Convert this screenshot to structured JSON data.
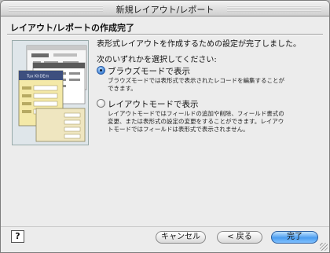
{
  "window": {
    "title": "新規レイアウト/レポート"
  },
  "heading": "レイアウト/レポートの作成完了",
  "lead": "表形式レイアウトを作成するための設定が完了しました。",
  "prompt": "次のいずれかを選択してください:",
  "options": [
    {
      "label": "ブラウズモードで表示",
      "selected": true,
      "description_lines": [
        "ブラウズモードでは表形式で表示されたレコードを編集することが",
        "できます。"
      ]
    },
    {
      "label": "レイアウトモードで表示",
      "selected": false,
      "description_lines": [
        "レイアウトモードではフィールドの追加や削除、フィールド書式の",
        "変更、または表形式の設定の変更をすることができます。レイアウ",
        "トモードではフィールドは表形式で表示されません。"
      ]
    }
  ],
  "illustration": {
    "card_title": "Tux KhDEm"
  },
  "buttons": {
    "help": "?",
    "cancel": "キャンセル",
    "back": "< 戻る",
    "finish": "完了"
  },
  "colors": {
    "accent": "#4c9df0",
    "card_header": "#3d4f7e",
    "card_body": "#f4e9a8"
  }
}
